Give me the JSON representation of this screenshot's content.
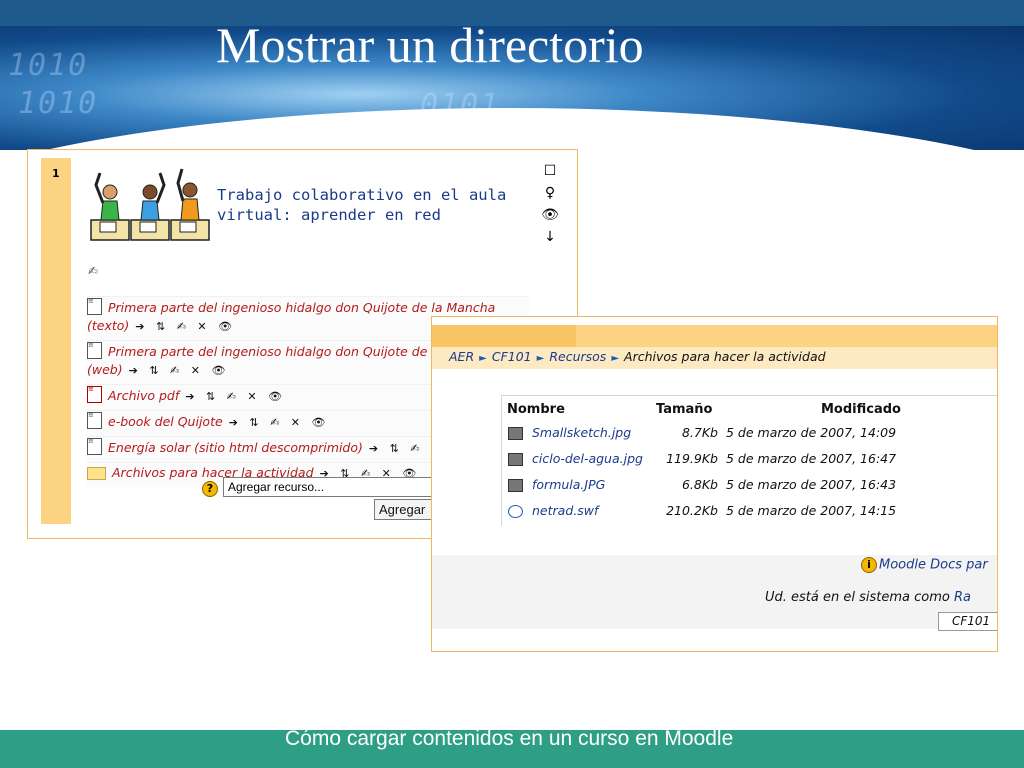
{
  "slide": {
    "title": "Mostrar un directorio",
    "footer": "Cómo cargar contenidos en un curso en Moodle",
    "banner_binary": [
      "1010",
      "1010",
      "0101"
    ]
  },
  "course_page": {
    "section_number": "1",
    "course_title_line1": "Trabajo colaborativo en el aula",
    "course_title_line2": "virtual: aprender en red",
    "right_icons": [
      "square-icon",
      "lightbulb-icon",
      "eye-icon",
      "arrow-down-icon"
    ],
    "resources": [
      {
        "text": "Primera parte del ingenioso hidalgo don Quijote de la Mancha (texto)",
        "icon": "text-page-icon",
        "actions": "➔ ⇅ ✍ ✕ 👁"
      },
      {
        "text": "Primera parte del ingenioso hidalgo don Quijote de la Mancha (web)",
        "icon": "text-page-icon",
        "actions": "➔ ⇅ ✍ ✕ 👁"
      },
      {
        "text": "Archivo pdf",
        "icon": "pdf-icon",
        "actions": "➔ ⇅ ✍ ✕ 👁"
      },
      {
        "text": "e-book del Quijote",
        "icon": "text-page-icon",
        "actions": "➔ ⇅ ✍ ✕ 👁"
      },
      {
        "text": "Energía solar (sitio html descomprimido)",
        "icon": "text-page-icon",
        "actions": "➔ ⇅ ✍ ✕ 👁"
      },
      {
        "text": "Archivos para hacer la actividad",
        "icon": "folder-icon",
        "actions": "➔ ⇅ ✍ ✕ 👁"
      }
    ],
    "add_resource_select": "Agregar recurso...",
    "add_activity_button": "Agregar"
  },
  "directory_page": {
    "breadcrumb": [
      "AER",
      "CF101",
      "Recursos"
    ],
    "breadcrumb_current": "Archivos para hacer la actividad",
    "columns": [
      "Nombre",
      "Tamaño",
      "Modificado"
    ],
    "files": [
      {
        "name": "Smallsketch.jpg",
        "size": "8.7Kb",
        "modified": "5 de marzo de 2007, 14:09",
        "icon": "image-file-icon"
      },
      {
        "name": "ciclo-del-agua.jpg",
        "size": "119.9Kb",
        "modified": "5 de marzo de 2007, 16:47",
        "icon": "image-file-icon"
      },
      {
        "name": "formula.JPG",
        "size": "6.8Kb",
        "modified": "5 de marzo de 2007, 16:43",
        "icon": "image-file-icon"
      },
      {
        "name": "netrad.swf",
        "size": "210.2Kb",
        "modified": "5 de marzo de 2007, 14:15",
        "icon": "flash-file-icon"
      }
    ],
    "docs_link": "Moodle Docs par",
    "logged_in_text": "Ud. está en el sistema como",
    "logged_in_user": "Ra",
    "course_select": "CF101"
  },
  "colors": {
    "banner_blue": "#1f5a8c",
    "footer_green": "#2e9e86",
    "moodle_orange": "#fcd383",
    "link_blue": "#1a3b8c",
    "resource_red": "#b31b1b"
  }
}
